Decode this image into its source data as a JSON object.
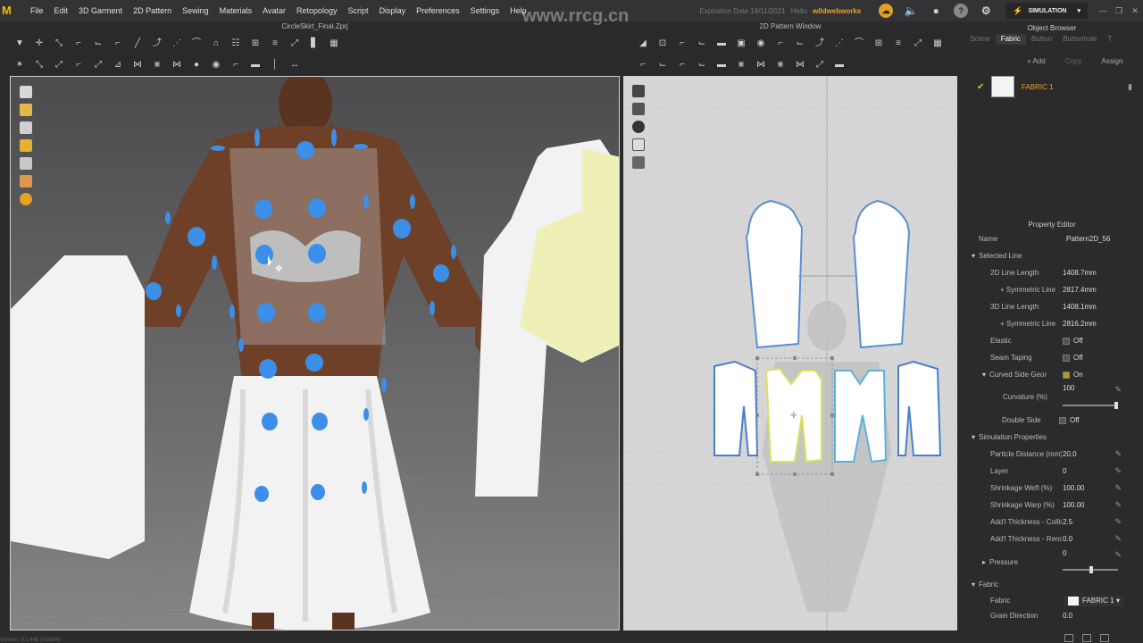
{
  "menubar": {
    "logo": "M",
    "items": [
      "File",
      "Edit",
      "3D Garment",
      "2D Pattern",
      "Sewing",
      "Materials",
      "Avatar",
      "Retopology",
      "Script",
      "Display",
      "Preferences",
      "Settings",
      "Help"
    ],
    "expiration": "Expiration Date 19/11/2021",
    "hello": "Hello",
    "username": "wildwebworks",
    "mode": "SIMULATION",
    "watermark": "www.rrcg.cn"
  },
  "windows": {
    "left_title": "CircleSkirt_Final.Zprj",
    "right_title": "2D Pattern Window"
  },
  "object_browser": {
    "title": "Object Browser",
    "tabs": [
      "Scene",
      "Fabric",
      "Button",
      "Buttonhole",
      "T"
    ],
    "active_tab": "Fabric",
    "add_label": "+ Add",
    "copy_label": "Copy",
    "assign_label": "Assign",
    "fabric_name": "FABRIC 1"
  },
  "property_editor": {
    "title": "Property Editor",
    "name_label": "Name",
    "name_value": "Pattern2D_56",
    "selected_line": "Selected Line",
    "line2d_label": "2D Line Length",
    "line2d_value": "1408.7mm",
    "sym1_label": "+ Symmetric Line",
    "sym1_value": "2817.4mm",
    "line3d_label": "3D Line Length",
    "line3d_value": "1408.1mm",
    "sym2_label": "+ Symmetric Line",
    "sym2_value": "2816.2mm",
    "elastic_label": "Elastic",
    "elastic_value": "Off",
    "seam_label": "Seam Taping",
    "seam_value": "Off",
    "curved_label": "Curved Side Geom",
    "curved_value": "On",
    "curvature_label": "Curvature (%)",
    "curvature_value": "100",
    "double_label": "Double Side",
    "double_value": "Off",
    "sim_props": "Simulation Properties",
    "particle_label": "Particle Distance (mm)",
    "particle_value": "20.0",
    "layer_label": "Layer",
    "layer_value": "0",
    "weft_label": "Shrinkage Weft (%)",
    "weft_value": "100.00",
    "warp_label": "Shrinkage Warp (%)",
    "warp_value": "100.00",
    "thick_coll_label": "Add'l Thickness - Collision",
    "thick_coll_value": "2.5",
    "thick_ren_label": "Add'l Thickness - Rendering",
    "thick_ren_value": "0.0",
    "pressure_label": "Pressure",
    "pressure_value": "0",
    "fabric_section": "Fabric",
    "fabric_label": "Fabric",
    "fabric_value": "FABRIC 1",
    "grain_label": "Grain Direction",
    "grain_value": "0.0"
  },
  "status": "Version: 5.1.445 (r28606)"
}
